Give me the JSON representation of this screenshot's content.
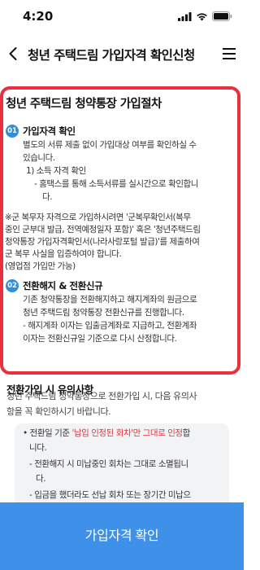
{
  "status_bar": {
    "time": "4:20"
  },
  "header": {
    "title": "청년 주택드림 가입자격 확인신청"
  },
  "procedure": {
    "title": "청년 주택드림 청약통장 가입절차",
    "steps": [
      {
        "number": "01",
        "title": "가입자격 확인",
        "lines": [
          "별도의 서류 제출 없이 가입대상 여부를 확인하실 수",
          "있습니다.",
          "1) 소득 자격 확인",
          "- 홈택스를 통해 소득서류를 실시간으로 확인합니",
          "다."
        ],
        "note_lines": [
          "※군 복무자 자격으로 가입하시려면 '군복무확인서(복무",
          "중인 군부대 발급, 전역예정일자 포함)' 혹은 '청년주택드림",
          "청약통장 가입자격확인서(나라사랑포털 발급)'를 제출하여",
          "군 복무 사실을 입증하여야 합니다.",
          "(영업점 가입만 가능)"
        ]
      },
      {
        "number": "02",
        "title": "전환해지 & 전환신규",
        "lines": [
          "기존 청약통장을 전환해지하고 해지계좌의 원금으로",
          "청년 주택드림 청약통장 전환신규를 진행합니다.",
          "- 해지계좌 이자는 입출금계좌로 지급하고, 전환계좌",
          "이자는 전환신규일 기준으로 다시 산정합니다."
        ]
      }
    ]
  },
  "caution": {
    "heading": "전환가입 시 유의사항",
    "desc_lines": [
      "청년 주택드림 청약통장으로 전환가입 시, 다음 유의사",
      "항을 꼭 확인하시기 바랍니다."
    ],
    "card": {
      "line1_prefix": "전환일 기준 ",
      "line1_highlight": "'납입 인정된 회차'만 그대로 인정",
      "line1_suffix": "합",
      "line2": "니다.",
      "line3": "- 전환해지 시 미납중인 회차는 그대로 소멸됩니",
      "line4": "다.",
      "line5": "- 입금을 했더라도 선납 회차 또는 장기간 미납으"
    }
  },
  "cta": {
    "label": "가입자격 확인"
  },
  "colors": {
    "accent": "#3e90e8",
    "highlight": "#e8303f",
    "step_badge": "#2f8fde"
  }
}
